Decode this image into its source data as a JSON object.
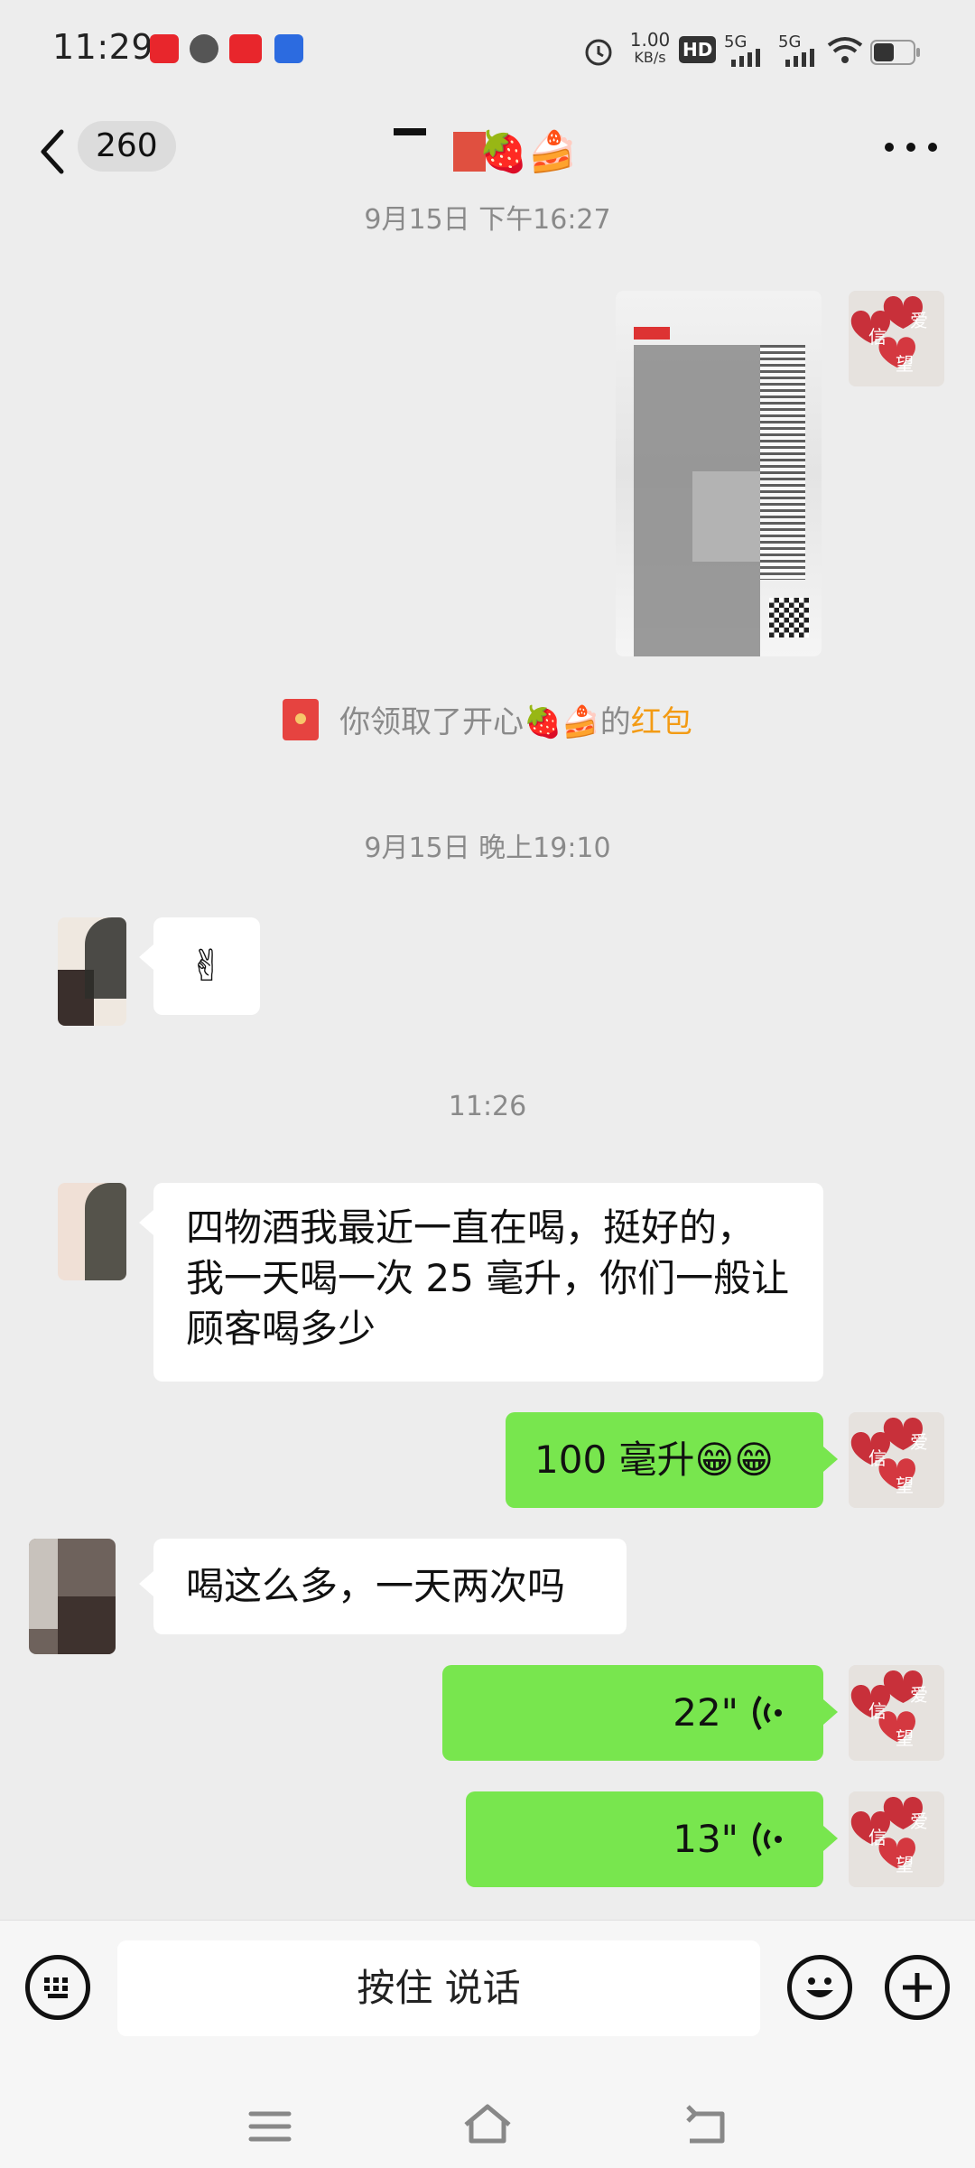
{
  "status_bar": {
    "time": "11:29",
    "speed": "1.00",
    "speed_unit": "KB/s",
    "app_icons": [
      "bank-app-icon",
      "chat-bubble-icon",
      "toutiao-app-icon",
      "paw-app-icon"
    ],
    "network1": "5G",
    "network2": "5G",
    "sim_label": "HD"
  },
  "navbar": {
    "unread_count": "260",
    "title": "🍓🍰"
  },
  "messages": {
    "ts1": "9月15日 下午16:27",
    "red_packet_prefix": "你领取了开心🍓🍰的",
    "red_packet_link": "红包",
    "ts2": "9月15日 晚上19:10",
    "msg_emoji": "✌",
    "ts3": "11:26",
    "msg_long": "四物酒我最近一直在喝，挺好的，我一天喝一次 25 毫升，你们一般让顾客喝多少",
    "msg_reply": "100 毫升😁😁",
    "msg_question": "喝这么多，一天两次吗",
    "voice1": "22\"",
    "voice2": "13\""
  },
  "self_avatar_chars": [
    "信",
    "爱",
    "望"
  ],
  "bottom": {
    "hold_to_talk": "按住 说话"
  },
  "colors": {
    "background": "#ededed",
    "self_bubble": "#78e64e",
    "red_packet": "#e64340",
    "link": "#f39b14"
  }
}
